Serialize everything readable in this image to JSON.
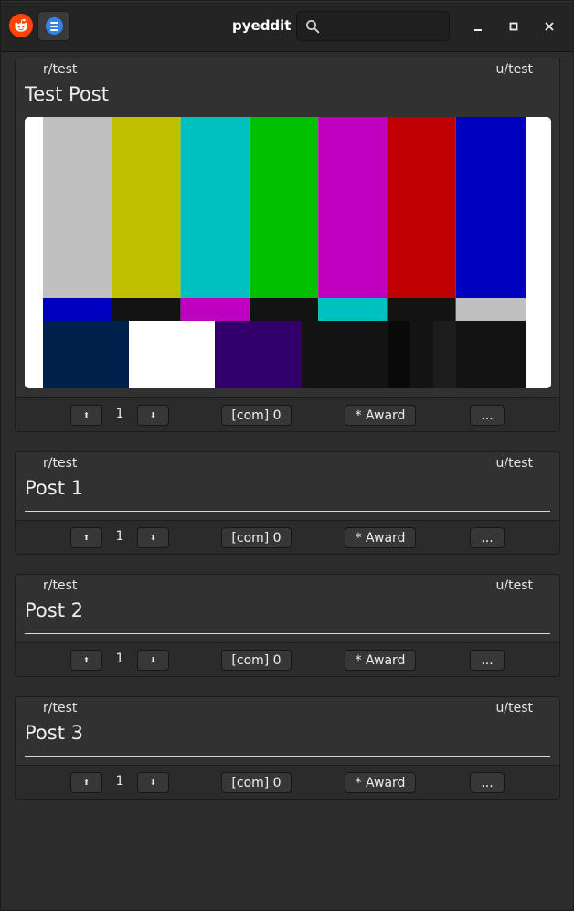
{
  "app": {
    "title": "pyeddit",
    "search_placeholder": "",
    "logo_icon": "reddit-alien-icon",
    "menu_icon": "hamburger-menu-icon",
    "accent": "#3584e4",
    "brand": "#ff4500"
  },
  "posts": [
    {
      "subreddit": "r/test",
      "user": "u/test",
      "title": "Test Post",
      "has_media": true,
      "votes": "1",
      "up": "⬆",
      "down": "⬇",
      "comments": "[com] 0",
      "award": "* Award",
      "more": "..."
    },
    {
      "subreddit": "r/test",
      "user": "u/test",
      "title": "Post 1",
      "has_media": false,
      "votes": "1",
      "up": "⬆",
      "down": "⬇",
      "comments": "[com] 0",
      "award": "* Award",
      "more": "..."
    },
    {
      "subreddit": "r/test",
      "user": "u/test",
      "title": "Post 2",
      "has_media": false,
      "votes": "1",
      "up": "⬆",
      "down": "⬇",
      "comments": "[com] 0",
      "award": "* Award",
      "more": "..."
    },
    {
      "subreddit": "r/test",
      "user": "u/test",
      "title": "Post 3",
      "has_media": false,
      "votes": "1",
      "up": "⬆",
      "down": "⬇",
      "comments": "[com] 0",
      "award": "* Award",
      "more": "..."
    }
  ],
  "media": {
    "description_icon": "smpte-color-bars-image",
    "top_bars": [
      "#c0c0c0",
      "#c0c000",
      "#00c0c0",
      "#00c000",
      "#c000c0",
      "#c00000",
      "#0000c0"
    ],
    "mid_bars": [
      "#0000c0",
      "#131313",
      "#c000c0",
      "#131313",
      "#00c0c0",
      "#131313",
      "#c0c0c0"
    ],
    "bottom_blocks": [
      "#00214c",
      "#ffffff",
      "#32006a",
      "#131313",
      "#090909",
      "#131313",
      "#1d1d1d",
      "#131313"
    ]
  }
}
